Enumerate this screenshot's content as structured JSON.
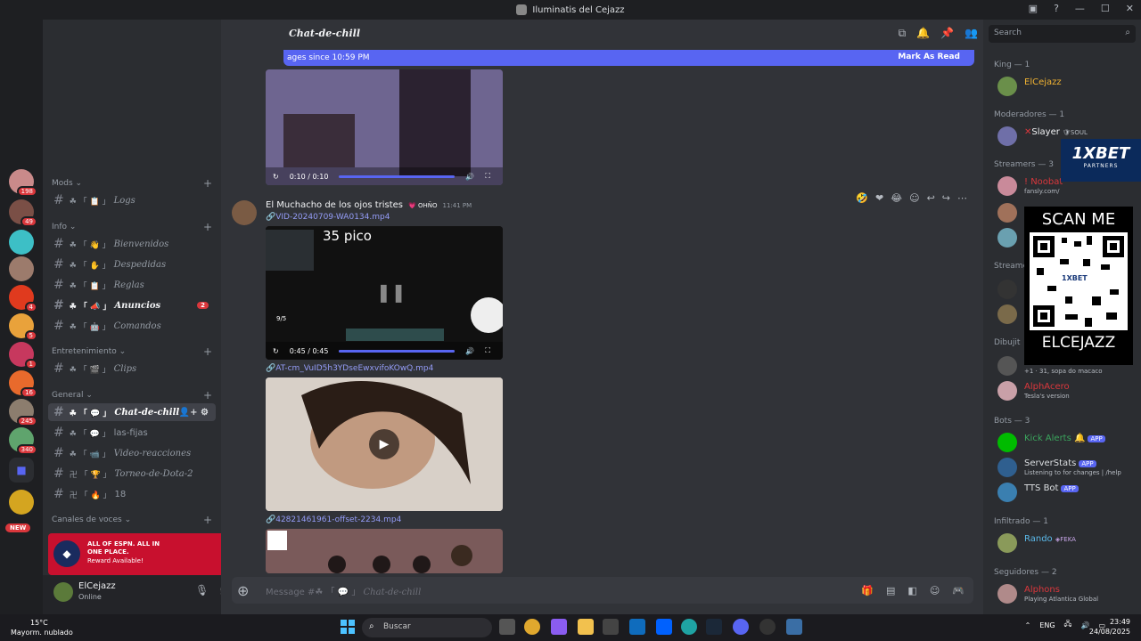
{
  "window": {
    "title": "Iluminatis del Cejazz"
  },
  "rail": {
    "badges": [
      "198",
      "49",
      "4",
      "5",
      "1",
      "16",
      "245",
      "340"
    ],
    "new_label": "NEW"
  },
  "sidebar": {
    "cat_mods": "Mods",
    "logs": "Logs",
    "cat_info": "Info",
    "bienvenidos": "Bienvenidos",
    "despedidas": "Despedidas",
    "reglas": "Reglas",
    "anuncios": "Anuncios",
    "anuncios_badge": "2",
    "comandos": "Comandos",
    "cat_ent": "Entretenimiento",
    "clips": "Clips",
    "cat_general": "General",
    "chat_de_chill": "Chat-de-chill",
    "las_fijas": "las-fijas",
    "video_reacciones": "Video-reacciones",
    "torneo": "Torneo-de-Dota-2",
    "eighteen": "18",
    "cat_voz": "Canales de voces"
  },
  "promo": {
    "line1": "ALL OF ESPN. ALL IN ONE PLACE.",
    "line2": "Reward Available!"
  },
  "user": {
    "name": "ElCejazz",
    "status": "Online"
  },
  "chat": {
    "channel": "Chat-de-chill",
    "new_since": "ages since 10:59 PM",
    "mark_read": "Mark As Read",
    "video1_time": "0:10 / 0:10",
    "author": "El Muchacho de los ojos tristes",
    "author_tag": "OHÑO",
    "time": "11:41 PM",
    "file1": "VID-20240709-WA0134.mp4",
    "overlay_text": "35 pico",
    "mini_label": "9/5",
    "video2_time": "0:45 / 0:45",
    "file2": "AT-cm_VuID5h3YDseEwxvifoKOwQ.mp4",
    "file3": "42821461961-offset-2234.mp4",
    "composer_prefix": "Message #",
    "composer_channel": "Chat-de-chill"
  },
  "members": {
    "search": "Search",
    "king_header": "King — 1",
    "king_name": "ElCejazz",
    "mods_header": "Moderadores — 1",
    "mod_name": "Slayer",
    "mod_tag": "SOUL",
    "streamers_header": "Streamers — 3",
    "streamer1": "! Noobat",
    "streamer1_sub": "fansly.com/",
    "streamers2_header": "Streame",
    "dibujo_header": "Dibujit",
    "dibujo_sub": "+1 · 31, sopa do macaco",
    "alpha_name": "AlphAcero",
    "alpha_sub": "Tesla's version",
    "bots_header": "Bots — 3",
    "bot1": "Kick Alerts",
    "bot2": "ServerStats",
    "bot2_sub": "Listening to for changes | /help",
    "bot3": "TTS Bot",
    "app_tag": "APP",
    "infiltrado_header": "Infiltrado — 1",
    "infiltrado_name": "Rando",
    "infiltrado_tag": "FEKA",
    "seguidores_header": "Seguidores — 2",
    "seg1": "Alphons",
    "seg1_sub": "Playing Atlantica Global"
  },
  "overlay": {
    "bet_logo": "1XBET",
    "bet_sub": "PARTNERS",
    "scan": "SCAN ME",
    "qr_center": "1XBET",
    "handle": "ELCEJAZZ"
  },
  "taskbar": {
    "temp": "15°C",
    "weather": "Mayorm. nublado",
    "search": "Buscar",
    "lang": "ENG",
    "time": "23:49",
    "date": "24/08/2025"
  },
  "colors": {
    "accent": "#5865f2",
    "mention": "#da373c",
    "king": "#f0b232",
    "link": "#949cf7"
  }
}
